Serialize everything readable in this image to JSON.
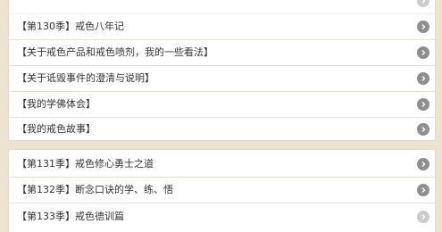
{
  "list_top": {
    "items": [
      {
        "label": "【第130季】戒色八年记"
      },
      {
        "label": "【关于戒色产品和戒色喷剂，我的一些看法】"
      },
      {
        "label": "【关于诋毁事件的澄清与说明】"
      },
      {
        "label": "【我的学佛体会】"
      },
      {
        "label": "【我的戒色故事】"
      }
    ]
  },
  "list_bottom": {
    "items": [
      {
        "label": "【第131季】戒色修心勇士之道"
      },
      {
        "label": "【第132季】断念口诀的学、练、悟"
      },
      {
        "label": "【第133季】戒色德训篇"
      }
    ]
  },
  "icons": {
    "row_arrow": "chevron-right-circle-icon"
  },
  "colors": {
    "background": "#ece4d0",
    "row": "#ffffff",
    "arrow": "#8f8f8f"
  }
}
